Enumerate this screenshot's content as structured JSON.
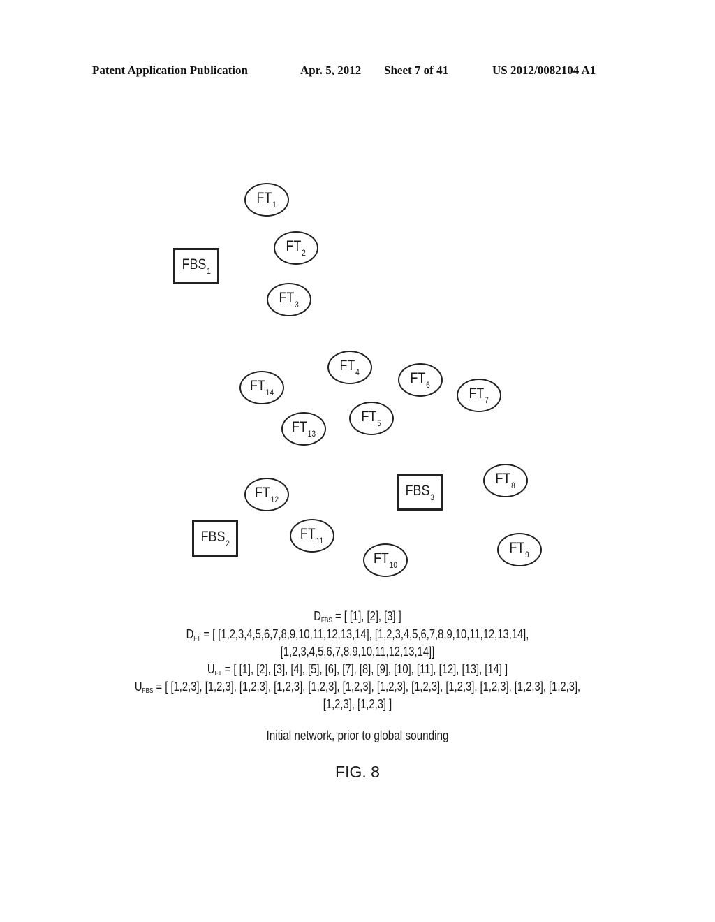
{
  "header": {
    "publication": "Patent Application Publication",
    "date": "Apr. 5, 2012",
    "sheet": "Sheet 7 of 41",
    "number": "US 2012/0082104 A1"
  },
  "nodes": [
    {
      "id": "ft1",
      "type": "terminal",
      "label": "FT",
      "sub": "1"
    },
    {
      "id": "ft2",
      "type": "terminal",
      "label": "FT",
      "sub": "2"
    },
    {
      "id": "fbs1",
      "type": "base_station",
      "label": "FBS",
      "sub": "1"
    },
    {
      "id": "ft3",
      "type": "terminal",
      "label": "FT",
      "sub": "3"
    },
    {
      "id": "ft4",
      "type": "terminal",
      "label": "FT",
      "sub": "4"
    },
    {
      "id": "ft14",
      "type": "terminal",
      "label": "FT",
      "sub": "14"
    },
    {
      "id": "ft6",
      "type": "terminal",
      "label": "FT",
      "sub": "6"
    },
    {
      "id": "ft7",
      "type": "terminal",
      "label": "FT",
      "sub": "7"
    },
    {
      "id": "ft5",
      "type": "terminal",
      "label": "FT",
      "sub": "5"
    },
    {
      "id": "ft13",
      "type": "terminal",
      "label": "FT",
      "sub": "13"
    },
    {
      "id": "ft8",
      "type": "terminal",
      "label": "FT",
      "sub": "8"
    },
    {
      "id": "fbs3",
      "type": "base_station",
      "label": "FBS",
      "sub": "3"
    },
    {
      "id": "ft12",
      "type": "terminal",
      "label": "FT",
      "sub": "12"
    },
    {
      "id": "fbs2",
      "type": "base_station",
      "label": "FBS",
      "sub": "2"
    },
    {
      "id": "ft11",
      "type": "terminal",
      "label": "FT",
      "sub": "11"
    },
    {
      "id": "ft9",
      "type": "terminal",
      "label": "FT",
      "sub": "9"
    },
    {
      "id": "ft10",
      "type": "terminal",
      "label": "FT",
      "sub": "10"
    }
  ],
  "equations": [
    {
      "var": "D",
      "sub": "FBS",
      "text": " = [ [1], [2], [3] ]"
    },
    {
      "var": "D",
      "sub": "FT",
      "text": " = [ [1,2,3,4,5,6,7,8,9,10,11,12,13,14], [1,2,3,4,5,6,7,8,9,10,11,12,13,14],"
    },
    {
      "var": "",
      "sub": "",
      "text": "[1,2,3,4,5,6,7,8,9,10,11,12,13,14]]"
    },
    {
      "var": "U",
      "sub": "FT",
      "text": " = [ [1], [2], [3], [4], [5], [6], [7], [8], [9], [10], [11], [12], [13], [14] ]"
    },
    {
      "var": "U",
      "sub": "FBS",
      "text": " = [ [1,2,3], [1,2,3], [1,2,3], [1,2,3], [1,2,3], [1,2,3], [1,2,3], [1,2,3], [1,2,3], [1,2,3], [1,2,3], [1,2,3],"
    },
    {
      "var": "",
      "sub": "",
      "text": "[1,2,3], [1,2,3] ]"
    }
  ],
  "caption": "Initial network, prior to global sounding",
  "figure_label": "FIG. 8"
}
